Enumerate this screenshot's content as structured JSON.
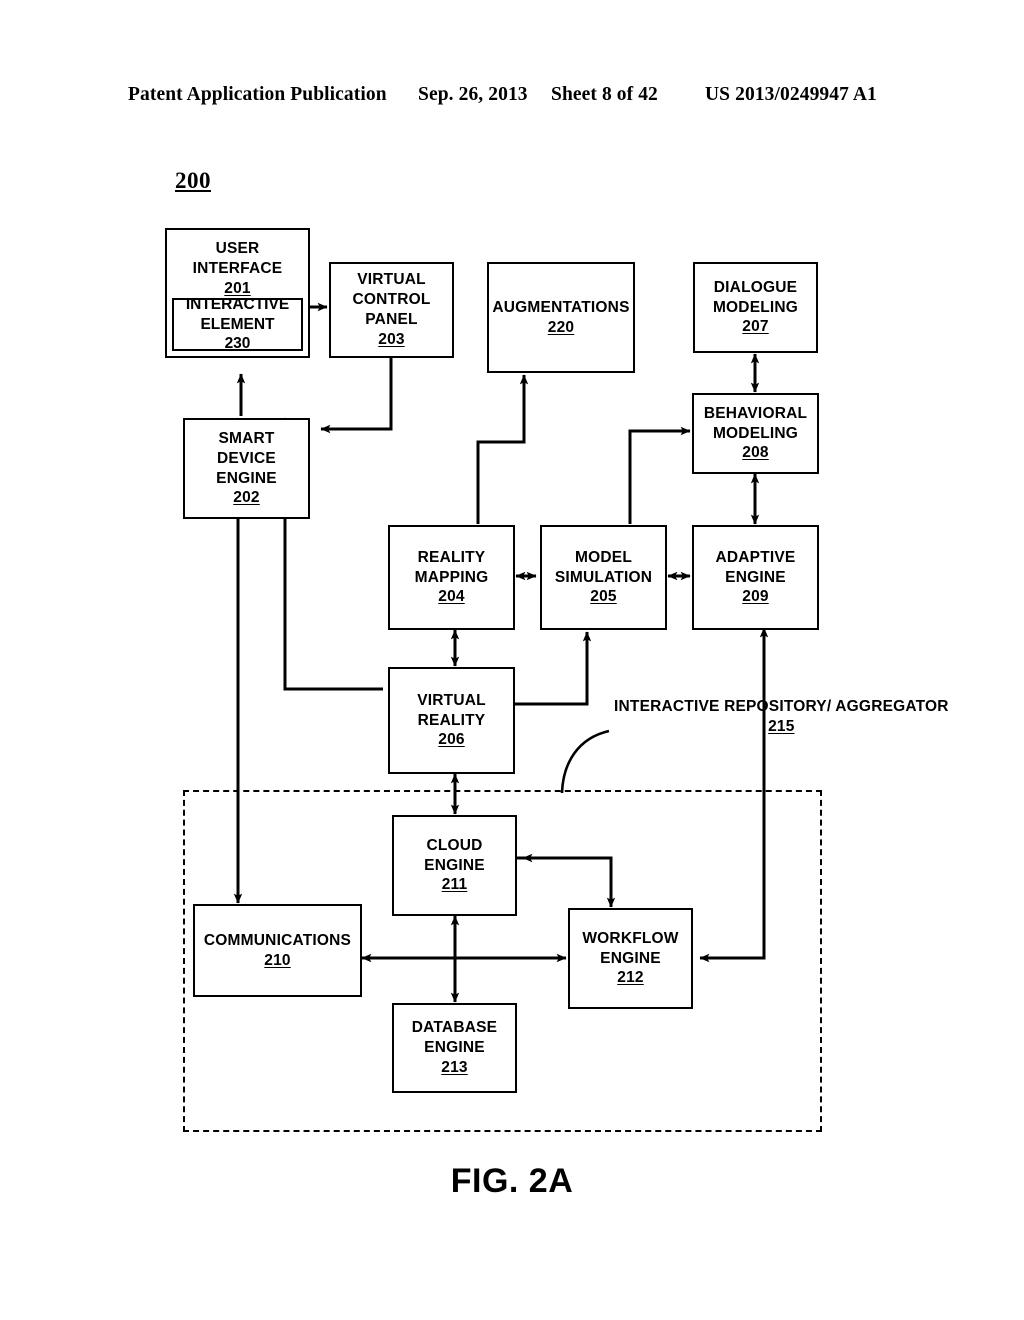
{
  "header": {
    "publication": "Patent Application Publication",
    "date": "Sep. 26, 2013",
    "sheet": "Sheet 8 of 42",
    "patent_number": "US 2013/0249947 A1"
  },
  "figure": {
    "system_ref": "200",
    "caption": "FIG. 2A"
  },
  "nodes": {
    "user_interface": {
      "l1": "USER",
      "l2": "INTERFACE",
      "ref": "201"
    },
    "interactive_element": {
      "l1": "INTERACTIVE",
      "l2": "ELEMENT",
      "ref": "230"
    },
    "virtual_control_panel": {
      "l1": "VIRTUAL",
      "l2": "CONTROL",
      "l3": "PANEL",
      "ref": "203"
    },
    "augmentations": {
      "l1": "AUGMENTATIONS",
      "ref": "220"
    },
    "dialogue_modeling": {
      "l1": "DIALOGUE",
      "l2": "MODELING",
      "ref": "207"
    },
    "smart_device_engine": {
      "l1": "SMART",
      "l2": "DEVICE",
      "l3": "ENGINE",
      "ref": "202"
    },
    "behavioral_modeling": {
      "l1": "BEHAVIORAL",
      "l2": "MODELING",
      "ref": "208"
    },
    "reality_mapping": {
      "l1": "REALITY",
      "l2": "MAPPING",
      "ref": "204"
    },
    "model_simulation": {
      "l1": "MODEL",
      "l2": "SIMULATION",
      "ref": "205"
    },
    "adaptive_engine": {
      "l1": "ADAPTIVE",
      "l2": "ENGINE",
      "ref": "209"
    },
    "virtual_reality": {
      "l1": "VIRTUAL",
      "l2": "REALITY",
      "ref": "206"
    },
    "cloud_engine": {
      "l1": "CLOUD",
      "l2": "ENGINE",
      "ref": "211"
    },
    "communications": {
      "l1": "COMMUNICATIONS",
      "ref": "210"
    },
    "workflow_engine": {
      "l1": "WORKFLOW",
      "l2": "ENGINE",
      "ref": "212"
    },
    "database_engine": {
      "l1": "DATABASE",
      "l2": "ENGINE",
      "ref": "213"
    }
  },
  "annotations": {
    "interactive_repository": {
      "l1": "INTERACTIVE",
      "l2": "REPOSITORY/",
      "l3": "AGGREGATOR",
      "ref": "215"
    }
  },
  "diagram_meta": {
    "type": "block-diagram",
    "stroke_color": "#000000",
    "fill_color": "#ffffff",
    "dashed_group_label": "INTERACTIVE REPOSITORY/ AGGREGATOR 215",
    "dashed_group_members": [
      "CLOUD ENGINE 211",
      "COMMUNICATIONS 210",
      "WORKFLOW ENGINE 212",
      "DATABASE ENGINE 213"
    ],
    "connections": [
      {
        "from": "USER INTERFACE 201",
        "to": "VIRTUAL CONTROL PANEL 203",
        "direction": "one-way"
      },
      {
        "from": "VIRTUAL CONTROL PANEL 203",
        "to": "SMART DEVICE ENGINE 202",
        "direction": "one-way"
      },
      {
        "from": "SMART DEVICE ENGINE 202",
        "to": "USER INTERFACE 201",
        "direction": "one-way"
      },
      {
        "from": "REALITY MAPPING 204",
        "to": "AUGMENTATIONS 220",
        "direction": "one-way"
      },
      {
        "from": "MODEL SIMULATION 205",
        "to": "BEHAVIORAL MODELING 208",
        "direction": "one-way"
      },
      {
        "from": "DIALOGUE MODELING 207",
        "to": "BEHAVIORAL MODELING 208",
        "direction": "two-way"
      },
      {
        "from": "BEHAVIORAL MODELING 208",
        "to": "ADAPTIVE ENGINE 209",
        "direction": "two-way"
      },
      {
        "from": "REALITY MAPPING 204",
        "to": "MODEL SIMULATION 205",
        "direction": "two-way"
      },
      {
        "from": "MODEL SIMULATION 205",
        "to": "ADAPTIVE ENGINE 209",
        "direction": "two-way"
      },
      {
        "from": "REALITY MAPPING 204",
        "to": "VIRTUAL REALITY 206",
        "direction": "two-way"
      },
      {
        "from": "VIRTUAL REALITY 206",
        "to": "MODEL SIMULATION 205",
        "direction": "one-way"
      },
      {
        "from": "VIRTUAL REALITY 206",
        "to": "SMART DEVICE ENGINE 202",
        "direction": "one-way"
      },
      {
        "from": "VIRTUAL REALITY 206",
        "to": "CLOUD ENGINE 211",
        "direction": "two-way"
      },
      {
        "from": "SMART DEVICE ENGINE 202",
        "to": "COMMUNICATIONS 210",
        "direction": "two-way"
      },
      {
        "from": "CLOUD ENGINE 211",
        "to": "WORKFLOW ENGINE 212",
        "direction": "one-way"
      },
      {
        "from": "WORKFLOW ENGINE 212",
        "to": "CLOUD ENGINE 211",
        "direction": "one-way"
      },
      {
        "from": "COMMUNICATIONS 210",
        "to": "WORKFLOW ENGINE 212",
        "direction": "two-way"
      },
      {
        "from": "CLOUD ENGINE 211",
        "to": "DATABASE ENGINE 213",
        "direction": "two-way"
      },
      {
        "from": "ADAPTIVE ENGINE 209",
        "to": "WORKFLOW ENGINE 212",
        "direction": "two-way"
      }
    ]
  }
}
